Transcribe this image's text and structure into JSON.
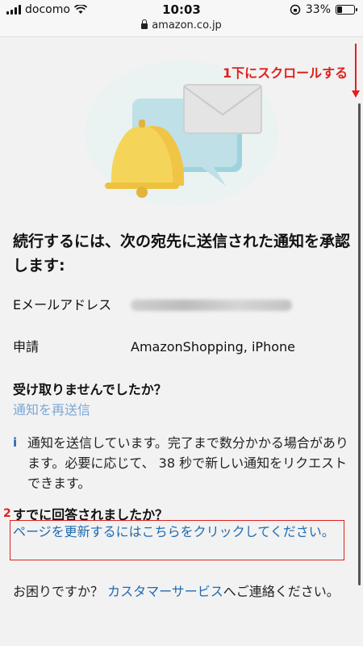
{
  "status_bar": {
    "carrier": "docomo",
    "time": "10:03",
    "battery": "33%",
    "battery_level": 0.33
  },
  "url_bar": {
    "url": "amazon.co.jp"
  },
  "annotations": {
    "step1": "1下にスクロールする",
    "step2": "2"
  },
  "heading": "続行するには、次の宛先に送信された通知を承認します:",
  "details": {
    "email_label": "Eメールアドレス",
    "request_label": "申請",
    "request_value": "AmazonShopping, iPhone"
  },
  "not_received": {
    "title": "受け取りませんでしたか？",
    "resend_link": "通知を再送信"
  },
  "notice_text": "通知を送信しています。完了まで数分かかる場合があります。必要に応じて、 38 秒で新しい通知をリクエストできます。",
  "answered": {
    "title": "すでに回答されましたか？",
    "refresh_link": "ページを更新するにはこちらをクリックしてください。"
  },
  "help": {
    "prefix": "お困りですか？ ",
    "link": "カスタマーサービス",
    "suffix": "へご連絡ください。"
  },
  "colors": {
    "link": "#1f6ab0",
    "annotation": "#e02020",
    "bell": "#f4d55a"
  }
}
